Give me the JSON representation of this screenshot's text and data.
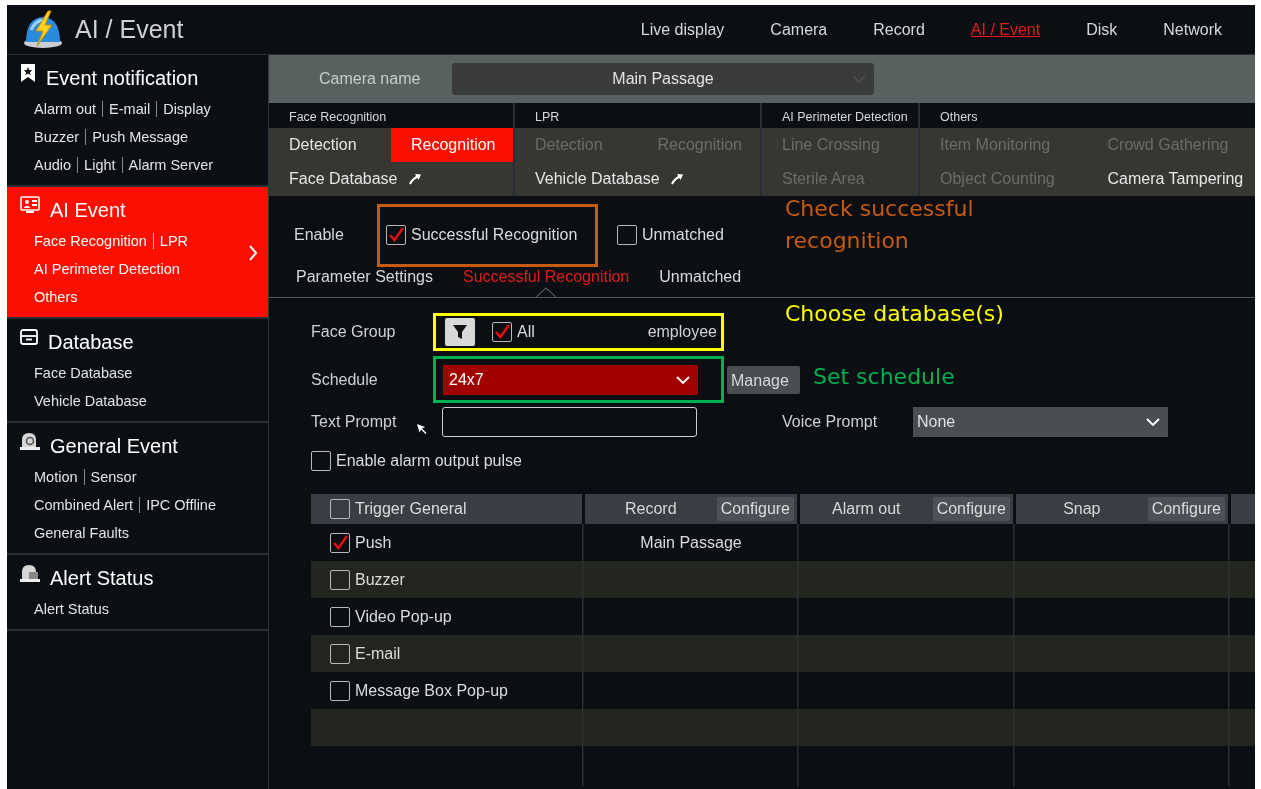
{
  "header": {
    "title": "AI / Event",
    "nav": [
      {
        "label": "Live display",
        "selected": false
      },
      {
        "label": "Camera",
        "selected": false
      },
      {
        "label": "Record",
        "selected": false
      },
      {
        "label": "AI / Event",
        "selected": true
      },
      {
        "label": "Disk",
        "selected": false
      },
      {
        "label": "Network",
        "selected": false
      }
    ]
  },
  "sidebar": {
    "sections": [
      {
        "title": "Event notification",
        "selected": false,
        "rows": [
          {
            "links": [
              "Alarm out",
              "E-mail",
              "Display"
            ]
          },
          {
            "links": [
              "Buzzer",
              "Push Message"
            ]
          },
          {
            "links": [
              "Audio",
              "Light",
              "Alarm Server"
            ]
          }
        ]
      },
      {
        "title": "AI Event",
        "selected": true,
        "rows": [
          {
            "links": [
              "Face Recognition",
              "LPR"
            ]
          },
          {
            "links": [
              "AI Perimeter Detection"
            ]
          },
          {
            "links": [
              "Others"
            ]
          }
        ]
      },
      {
        "title": "Database",
        "selected": false,
        "rows": [
          {
            "links": [
              "Face Database"
            ]
          },
          {
            "links": [
              "Vehicle Database"
            ]
          }
        ]
      },
      {
        "title": "General Event",
        "selected": false,
        "rows": [
          {
            "links": [
              "Motion",
              "Sensor"
            ]
          },
          {
            "links": [
              "Combined Alert",
              "IPC Offline"
            ]
          },
          {
            "links": [
              "General Faults"
            ]
          }
        ]
      },
      {
        "title": "Alert Status",
        "selected": false,
        "rows": [
          {
            "links": [
              "Alert Status"
            ]
          }
        ]
      }
    ]
  },
  "camera": {
    "label": "Camera name",
    "value": "Main Passage"
  },
  "function_groups": [
    {
      "heading": "Face Recognition",
      "rows": [
        [
          {
            "label": "Detection",
            "kind": "tab",
            "selected": false,
            "disabled": false
          },
          {
            "label": "Recognition",
            "kind": "tab",
            "selected": true,
            "disabled": false
          }
        ],
        [
          {
            "label": "Face Database",
            "kind": "link",
            "selected": false,
            "disabled": false
          }
        ]
      ]
    },
    {
      "heading": "LPR",
      "rows": [
        [
          {
            "label": "Detection",
            "kind": "tab",
            "selected": false,
            "disabled": true
          },
          {
            "label": "Recognition",
            "kind": "tab",
            "selected": false,
            "disabled": true
          }
        ],
        [
          {
            "label": "Vehicle Database",
            "kind": "link",
            "selected": false,
            "disabled": false
          }
        ]
      ]
    },
    {
      "heading": "AI Perimeter Detection",
      "rows": [
        [
          {
            "label": "Line Crossing",
            "kind": "tab",
            "selected": false,
            "disabled": true
          }
        ],
        [
          {
            "label": "Sterile Area",
            "kind": "tab",
            "selected": false,
            "disabled": true
          }
        ]
      ]
    },
    {
      "heading": "Others",
      "rows": [
        [
          {
            "label": "Item Monitoring",
            "kind": "tab",
            "selected": false,
            "disabled": true
          },
          {
            "label": "Crowd Gathering",
            "kind": "tab",
            "selected": false,
            "disabled": true
          }
        ],
        [
          {
            "label": "Object Counting",
            "kind": "tab",
            "selected": false,
            "disabled": true
          },
          {
            "label": "Camera Tampering",
            "kind": "tab",
            "selected": false,
            "disabled": false
          }
        ]
      ]
    }
  ],
  "enable": {
    "label": "Enable",
    "options": [
      {
        "label": "Successful Recognition",
        "checked": true,
        "highlighted": true
      },
      {
        "label": "Unmatched",
        "checked": false
      }
    ]
  },
  "subtabs": [
    {
      "label": "Parameter Settings",
      "selected": false
    },
    {
      "label": "Successful Recognition",
      "selected": true
    },
    {
      "label": "Unmatched",
      "selected": false
    }
  ],
  "face_group": {
    "label": "Face Group",
    "all_label": "All",
    "all_checked": true,
    "value": "employee"
  },
  "schedule": {
    "label": "Schedule",
    "value": "24x7",
    "button": "Manage"
  },
  "text_prompt": {
    "label": "Text Prompt"
  },
  "voice_prompt": {
    "label": "Voice Prompt",
    "value": "None"
  },
  "pulse": {
    "label": "Enable alarm output pulse",
    "checked": false
  },
  "table": {
    "columns": [
      {
        "label": "Trigger General",
        "kind": "trigger",
        "checked": false
      },
      {
        "label": "Record",
        "kind": "action",
        "button": "Configure"
      },
      {
        "label": "Alarm out",
        "kind": "action",
        "button": "Configure"
      },
      {
        "label": "Snap",
        "kind": "action",
        "button": "Configure"
      }
    ],
    "rows": [
      {
        "label": "Push",
        "checked": true,
        "record": "Main Passage"
      },
      {
        "label": "Buzzer",
        "checked": false
      },
      {
        "label": "Video Pop-up",
        "checked": false
      },
      {
        "label": "E-mail",
        "checked": false
      },
      {
        "label": "Message Box Pop-up",
        "checked": false
      }
    ]
  },
  "annotations": [
    {
      "text": "Check successful recognition",
      "color": "#c55a11"
    },
    {
      "text": "Choose database(s)",
      "color": "#ffff00"
    },
    {
      "text": "Set schedule",
      "color": "#00b050"
    }
  ]
}
